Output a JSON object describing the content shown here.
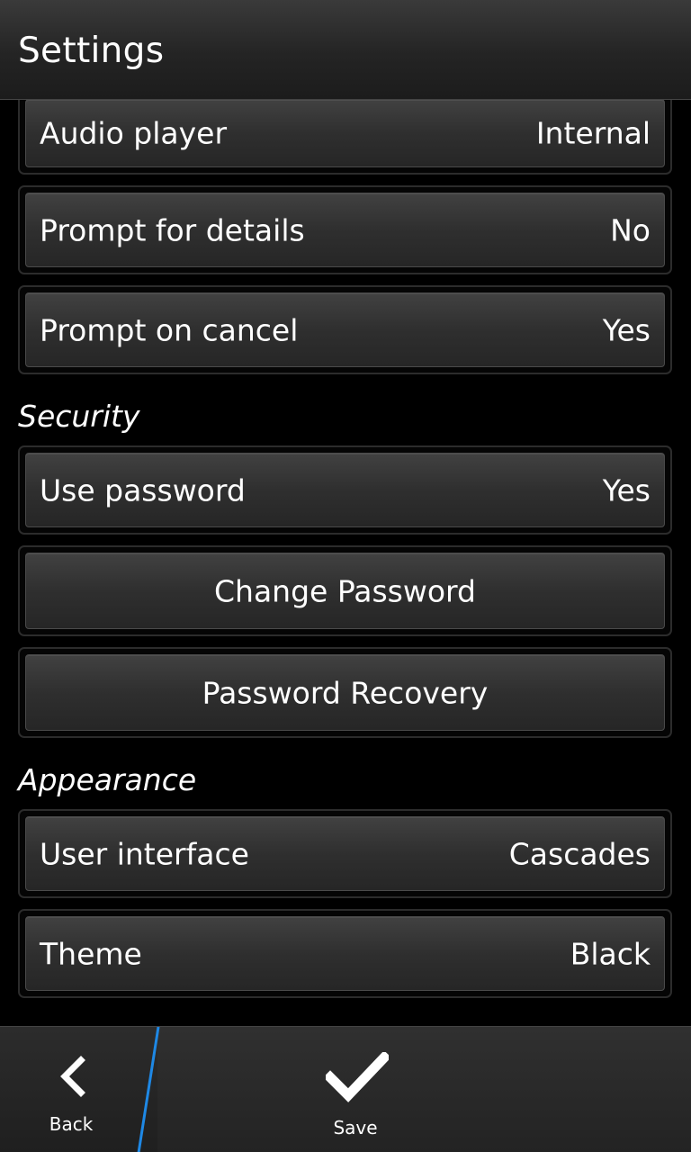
{
  "header": {
    "title": "Settings"
  },
  "general": {
    "audio_player": {
      "label": "Audio player",
      "value": "Internal"
    },
    "prompt_details": {
      "label": "Prompt for details",
      "value": "No"
    },
    "prompt_cancel": {
      "label": "Prompt on cancel",
      "value": "Yes"
    }
  },
  "security": {
    "heading": "Security",
    "use_password": {
      "label": "Use password",
      "value": "Yes"
    },
    "change_password": "Change Password",
    "password_recovery": "Password Recovery"
  },
  "appearance": {
    "heading": "Appearance",
    "user_interface": {
      "label": "User interface",
      "value": "Cascades"
    },
    "theme": {
      "label": "Theme",
      "value": "Black"
    }
  },
  "actionbar": {
    "back_label": "Back",
    "back_icon": "chevron-left-icon",
    "save_label": "Save",
    "save_icon": "checkmark-icon",
    "accent_color": "#1e88e5"
  }
}
